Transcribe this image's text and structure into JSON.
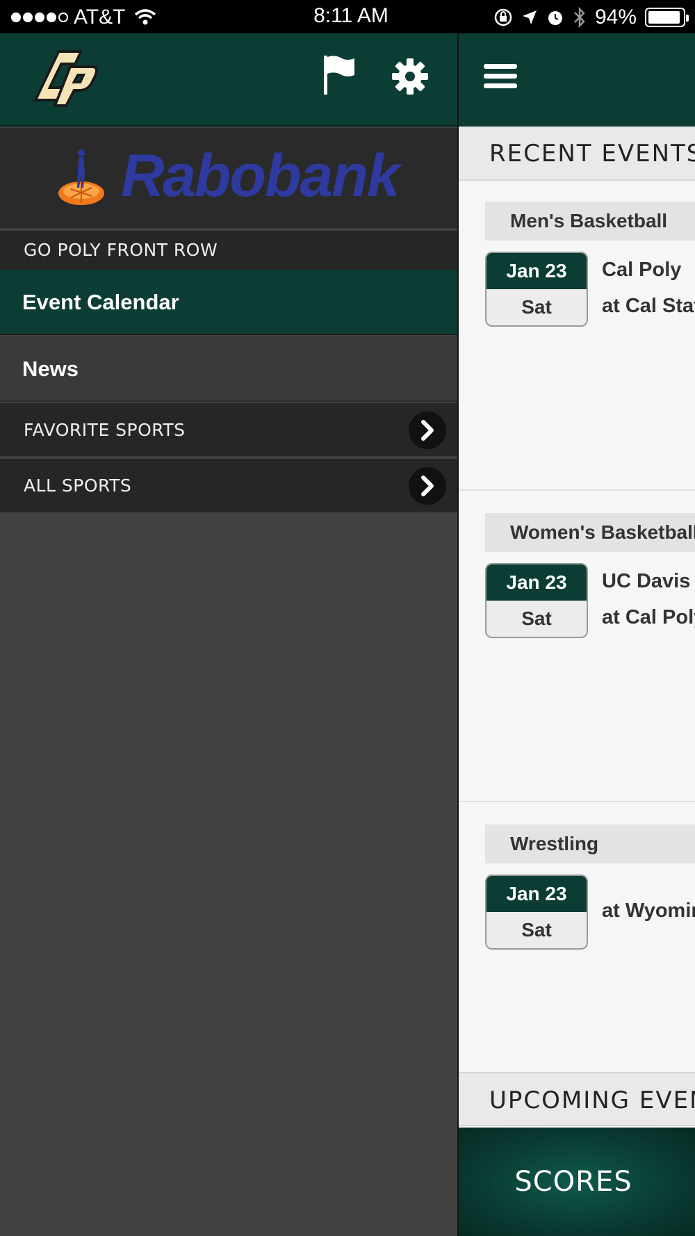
{
  "status_bar": {
    "carrier": "AT&T",
    "time": "8:11 AM",
    "battery": "94%",
    "battery_level": 0.94,
    "icons": [
      "signal-dots",
      "wifi-icon",
      "orientation-lock-icon",
      "location-arrow-icon",
      "alarm-icon",
      "bluetooth-icon",
      "battery-icon"
    ]
  },
  "drawer": {
    "header_icons": [
      "cal-poly-logo",
      "flag-icon",
      "gear-icon"
    ],
    "sponsor": {
      "name": "Rabobank"
    },
    "front_row_label": "GO POLY FRONT ROW",
    "menu": {
      "event_calendar": "Event Calendar",
      "news": "News",
      "favorite_sports": "FAVORITE SPORTS",
      "all_sports": "ALL SPORTS"
    }
  },
  "content": {
    "recent_title": "RECENT EVENTS",
    "upcoming_title": "UPCOMING EVENTS",
    "scores_label": "SCORES",
    "events": [
      {
        "sport": "Men's Basketball",
        "date": "Jan 23",
        "day": "Sat",
        "line1": "Cal Poly",
        "line2": "at Cal State Fullerton"
      },
      {
        "sport": "Women's Basketball",
        "date": "Jan 23",
        "day": "Sat",
        "line1": "UC Davis",
        "line2": "at Cal Poly"
      },
      {
        "sport": "Wrestling",
        "date": "Jan 23",
        "day": "Sat",
        "line1": "at Wyoming"
      }
    ]
  },
  "colors": {
    "brand_green": "#0b3d34",
    "drawer_bg": "#424242",
    "sponsor_blue": "#2e3aa0",
    "logo_gold": "#f4e4b8"
  }
}
